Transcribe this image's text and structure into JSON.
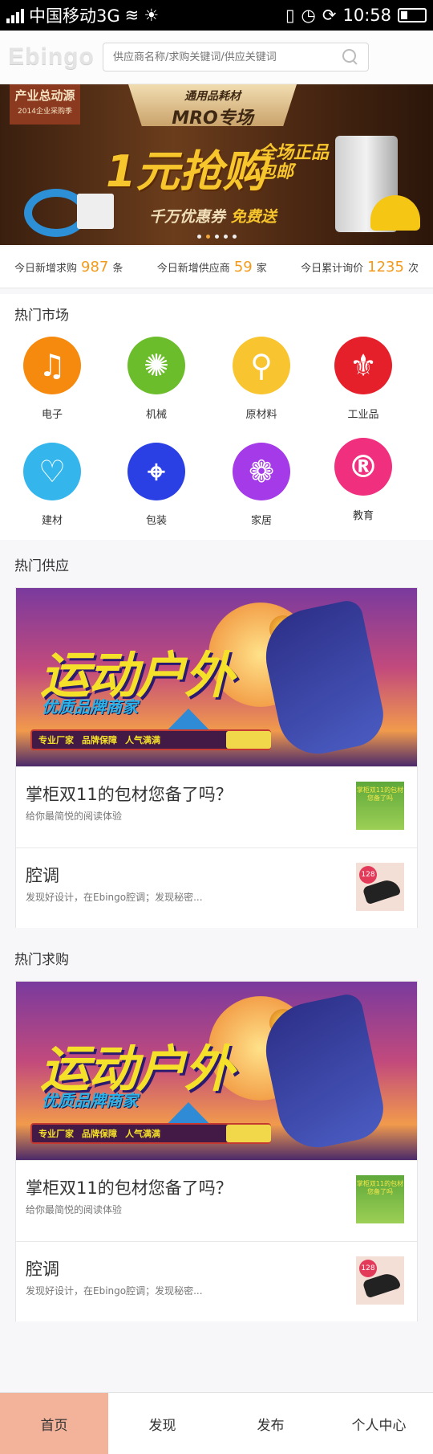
{
  "status_bar": {
    "carrier": "中国移动3G",
    "time": "10:58"
  },
  "header": {
    "logo": "Ebingo",
    "search_placeholder": "供应商名称/求购关键词/供应关键词"
  },
  "banner": {
    "ribbon_title": "产业总动源",
    "ribbon_sub": "2014企业采购季",
    "plate_top": "通用品耗材",
    "plate_main": "MRO专场",
    "headline": "1元抢购",
    "side_line1": "全场正品",
    "side_line2": "包邮",
    "sub_part1": "千万优惠券 ",
    "sub_part2": "免费送",
    "active_dot": 1,
    "dot_count": 5
  },
  "stats": [
    {
      "label": "今日新增求购",
      "value": "987",
      "unit": "条"
    },
    {
      "label": "今日新增供应商",
      "value": "59",
      "unit": "家"
    },
    {
      "label": "今日累计询价",
      "value": "1235",
      "unit": "次"
    }
  ],
  "market": {
    "title": "热门市场",
    "categories": [
      {
        "label": "电子",
        "icon": "music-note-icon",
        "color": "#f58a0e"
      },
      {
        "label": "机械",
        "icon": "burst-icon",
        "color": "#6cbd2b"
      },
      {
        "label": "原材料",
        "icon": "pin-icon",
        "color": "#f8c530"
      },
      {
        "label": "工业品",
        "icon": "fleur-de-lis-icon",
        "color": "#e5202a"
      },
      {
        "label": "建材",
        "icon": "bird-heart-icon",
        "color": "#34b5ec"
      },
      {
        "label": "包装",
        "icon": "crosshair-icon",
        "color": "#2b40e4"
      },
      {
        "label": "家居",
        "icon": "paw-icon",
        "color": "#a53ae8"
      },
      {
        "label": "教育",
        "icon": "registered-icon",
        "color": "#f0307f"
      }
    ]
  },
  "supply": {
    "title": "热门供应",
    "promo_title": "运动户外",
    "promo_sub": "优质品牌商家",
    "promo_tags": [
      "专业厂家",
      "品牌保障",
      "人气满满"
    ],
    "items": [
      {
        "title": "掌柜双11的包材您备了吗？",
        "desc": "给你最简悦的阅读体验",
        "thumb_text": "掌柜双11的包材您备了吗"
      },
      {
        "title": "腔调",
        "desc": "发现好设计，在Ebingo腔调；发现秘密...",
        "thumb_badge": "128"
      }
    ]
  },
  "demand": {
    "title": "热门求购",
    "promo_title": "运动户外",
    "promo_sub": "优质品牌商家",
    "promo_tags": [
      "专业厂家",
      "品牌保障",
      "人气满满"
    ],
    "items": [
      {
        "title": "掌柜双11的包材您备了吗？",
        "desc": "给你最简悦的阅读体验",
        "thumb_text": "掌柜双11的包材您备了吗"
      },
      {
        "title": "腔调",
        "desc": "发现好设计，在Ebingo腔调；发现秘密...",
        "thumb_badge": "128"
      }
    ]
  },
  "tabbar": {
    "tabs": [
      "首页",
      "发现",
      "发布",
      "个人中心"
    ],
    "active": 0
  }
}
